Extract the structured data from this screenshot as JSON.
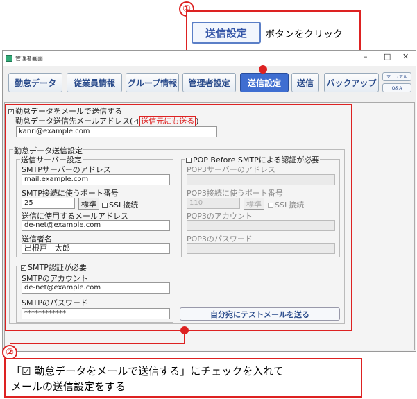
{
  "callout1": {
    "number": "①",
    "button_label": "送信設定",
    "text": "ボタンをクリック"
  },
  "window": {
    "title": "管理者画面",
    "min": "–",
    "max": "□",
    "close": "✕"
  },
  "toolbar": {
    "kintai": "勤怠データ",
    "jugyoin": "従業員情報",
    "group": "グループ情報",
    "kanrisha": "管理者設定",
    "soshin_settei": "送信設定",
    "soshin": "送信",
    "backup": "バックアップ",
    "manual": "マニュアル",
    "qa": "Q＆A"
  },
  "form": {
    "main_check": "勤怠データをメールで送信する",
    "dest_label_a": "勤怠データ送信先メールアドレス(",
    "dest_label_b": "送信元にも送る",
    "dest_label_c": ")",
    "dest_value": "kanri@example.com",
    "settings_group": "勤怠データ送信設定",
    "server_group": "送信サーバー設定",
    "smtp_server_label": "SMTPサーバーのアドレス",
    "smtp_server_value": "mail.example.com",
    "smtp_port_label": "SMTP接続に使うポート番号",
    "smtp_port_value": "25",
    "std_button": "標準",
    "ssl_label": "SSL接続",
    "from_label": "送信に使用するメールアドレス",
    "from_value": "de-net@example.com",
    "sender_label": "送信者名",
    "sender_value": "出根戸　太郎",
    "smtp_auth_check": "SMTP認証が必要",
    "smtp_account_label": "SMTPのアカウント",
    "smtp_account_value": "de-net@example.com",
    "smtp_pass_label": "SMTPのパスワード",
    "smtp_pass_value": "************",
    "pop_check": "POP Before SMTPによる認証が必要",
    "pop3_server_label": "POP3サーバーのアドレス",
    "pop3_port_label": "POP3接続に使うポート番号",
    "pop3_port_value": "110",
    "pop3_account_label": "POP3のアカウント",
    "pop3_pass_label": "POP3のパスワード",
    "test_button": "自分宛にテストメールを送る"
  },
  "callout2": {
    "number": "②",
    "line1": "「☑ 勤怠データをメールで送信する」にチェックを入れて",
    "line2": "メールの送信設定をする"
  },
  "colors": {
    "accent_red": "#dd2222",
    "active_blue": "#3f6ed1"
  }
}
